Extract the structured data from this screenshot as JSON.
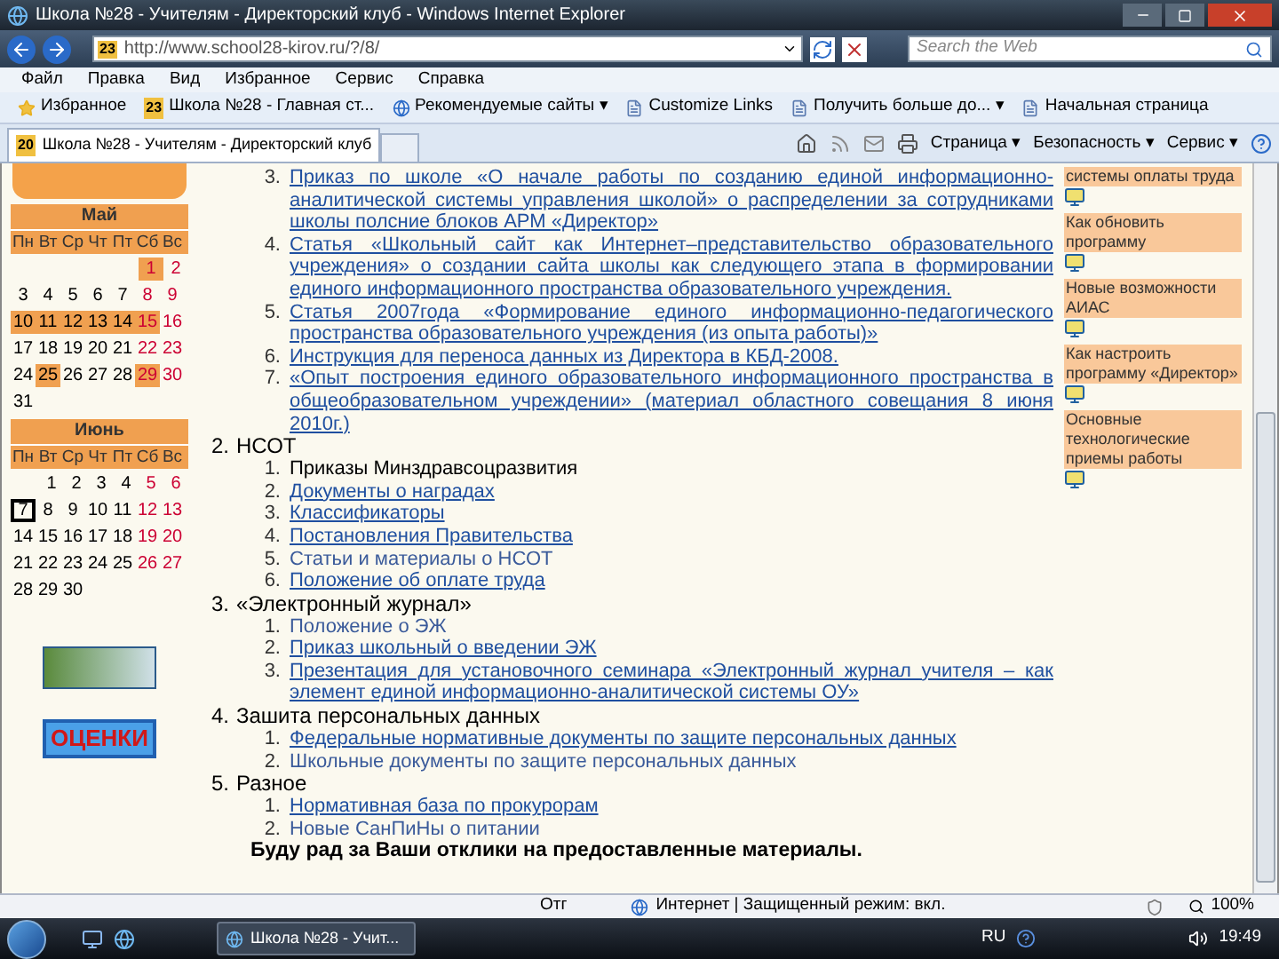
{
  "window": {
    "title": "Школа №28 - Учителям - Директорский клуб - Windows Internet Explorer"
  },
  "address_bar": {
    "favicon": "23",
    "url": "http://www.school28-kirov.ru/?/8/"
  },
  "search": {
    "placeholder": "Search the Web"
  },
  "menu": [
    "Файл",
    "Правка",
    "Вид",
    "Избранное",
    "Сервис",
    "Справка"
  ],
  "favorites_bar": [
    {
      "kind": "star",
      "label": "Избранное"
    },
    {
      "kind": "site",
      "label": "Школа №28 - Главная ст...",
      "badge": "23"
    },
    {
      "kind": "ie",
      "label": "Рекомендуемые сайты ▾"
    },
    {
      "kind": "page",
      "label": "Customize Links"
    },
    {
      "kind": "page",
      "label": "Получить больше до...  ▾"
    },
    {
      "kind": "page",
      "label": "Начальная страница"
    }
  ],
  "tabs": [
    {
      "label": "Школа №28 - Учителям - Директорский клуб",
      "favicon": "20",
      "selected": true
    }
  ],
  "command_bar": [
    "Страница ▾",
    "Безопасность ▾",
    "Сервис ▾"
  ],
  "calendar": {
    "months": [
      {
        "name": "Май",
        "weekdays": [
          "Пн",
          "Вт",
          "Ср",
          "Чт",
          "Пт",
          "Сб",
          "Вс"
        ],
        "weeks": [
          [
            {
              "day": "1",
              "highlighted": true,
              "weekend": true,
              "today": false
            },
            {
              "day": "2",
              "highlighted": false,
              "weekend": true,
              "today": false
            }
          ],
          [
            {
              "day": "3",
              "highlighted": false,
              "weekend": false,
              "today": false
            },
            {
              "day": "4",
              "highlighted": false,
              "weekend": false,
              "today": false
            },
            {
              "day": "5",
              "highlighted": false,
              "weekend": false,
              "today": false
            },
            {
              "day": "6",
              "highlighted": false,
              "weekend": false,
              "today": false
            },
            {
              "day": "7",
              "highlighted": false,
              "weekend": false,
              "today": false
            },
            {
              "day": "8",
              "highlighted": false,
              "weekend": true,
              "today": false
            },
            {
              "day": "9",
              "highlighted": false,
              "weekend": true,
              "today": false
            }
          ],
          [
            {
              "day": "10",
              "highlighted": true,
              "weekend": false,
              "today": false
            },
            {
              "day": "11",
              "highlighted": true,
              "weekend": false,
              "today": false
            },
            {
              "day": "12",
              "highlighted": true,
              "weekend": false,
              "today": false
            },
            {
              "day": "13",
              "highlighted": true,
              "weekend": false,
              "today": false
            },
            {
              "day": "14",
              "highlighted": true,
              "weekend": false,
              "today": false
            },
            {
              "day": "15",
              "highlighted": true,
              "weekend": true,
              "today": false
            },
            {
              "day": "16",
              "highlighted": false,
              "weekend": true,
              "today": false
            }
          ],
          [
            {
              "day": "17",
              "highlighted": false,
              "weekend": false,
              "today": false
            },
            {
              "day": "18",
              "highlighted": false,
              "weekend": false,
              "today": false
            },
            {
              "day": "19",
              "highlighted": false,
              "weekend": false,
              "today": false
            },
            {
              "day": "20",
              "highlighted": false,
              "weekend": false,
              "today": false
            },
            {
              "day": "21",
              "highlighted": false,
              "weekend": false,
              "today": false
            },
            {
              "day": "22",
              "highlighted": false,
              "weekend": true,
              "today": false
            },
            {
              "day": "23",
              "highlighted": false,
              "weekend": true,
              "today": false
            }
          ],
          [
            {
              "day": "24",
              "highlighted": false,
              "weekend": false,
              "today": false
            },
            {
              "day": "25",
              "highlighted": true,
              "weekend": false,
              "today": false
            },
            {
              "day": "26",
              "highlighted": false,
              "weekend": false,
              "today": false
            },
            {
              "day": "27",
              "highlighted": false,
              "weekend": false,
              "today": false
            },
            {
              "day": "28",
              "highlighted": false,
              "weekend": false,
              "today": false
            },
            {
              "day": "29",
              "highlighted": true,
              "weekend": true,
              "today": false
            },
            {
              "day": "30",
              "highlighted": false,
              "weekend": true,
              "today": false
            }
          ],
          [
            {
              "day": "31",
              "highlighted": false,
              "weekend": false,
              "today": false
            }
          ]
        ]
      },
      {
        "name": "Июнь",
        "weekdays": [
          "Пн",
          "Вт",
          "Ср",
          "Чт",
          "Пт",
          "Сб",
          "Вс"
        ],
        "weeks": [
          [
            {
              "day": "1",
              "highlighted": false,
              "weekend": false,
              "today": false
            },
            {
              "day": "2",
              "highlighted": false,
              "weekend": false,
              "today": false
            },
            {
              "day": "3",
              "highlighted": false,
              "weekend": false,
              "today": false
            },
            {
              "day": "4",
              "highlighted": false,
              "weekend": false,
              "today": false
            },
            {
              "day": "5",
              "highlighted": false,
              "weekend": true,
              "today": false
            },
            {
              "day": "6",
              "highlighted": false,
              "weekend": true,
              "today": false
            }
          ],
          [
            {
              "day": "7",
              "highlighted": false,
              "weekend": false,
              "today": true
            },
            {
              "day": "8",
              "highlighted": false,
              "weekend": false,
              "today": false
            },
            {
              "day": "9",
              "highlighted": false,
              "weekend": false,
              "today": false
            },
            {
              "day": "10",
              "highlighted": false,
              "weekend": false,
              "today": false
            },
            {
              "day": "11",
              "highlighted": false,
              "weekend": false,
              "today": false
            },
            {
              "day": "12",
              "highlighted": false,
              "weekend": true,
              "today": false
            },
            {
              "day": "13",
              "highlighted": false,
              "weekend": true,
              "today": false
            }
          ],
          [
            {
              "day": "14",
              "highlighted": false,
              "weekend": false,
              "today": false
            },
            {
              "day": "15",
              "highlighted": false,
              "weekend": false,
              "today": false
            },
            {
              "day": "16",
              "highlighted": false,
              "weekend": false,
              "today": false
            },
            {
              "day": "17",
              "highlighted": false,
              "weekend": false,
              "today": false
            },
            {
              "day": "18",
              "highlighted": false,
              "weekend": false,
              "today": false
            },
            {
              "day": "19",
              "highlighted": false,
              "weekend": true,
              "today": false
            },
            {
              "day": "20",
              "highlighted": false,
              "weekend": true,
              "today": false
            }
          ],
          [
            {
              "day": "21",
              "highlighted": false,
              "weekend": false,
              "today": false
            },
            {
              "day": "22",
              "highlighted": false,
              "weekend": false,
              "today": false
            },
            {
              "day": "23",
              "highlighted": false,
              "weekend": false,
              "today": false
            },
            {
              "day": "24",
              "highlighted": false,
              "weekend": false,
              "today": false
            },
            {
              "day": "25",
              "highlighted": false,
              "weekend": false,
              "today": false
            },
            {
              "day": "26",
              "highlighted": false,
              "weekend": true,
              "today": false
            },
            {
              "day": "27",
              "highlighted": false,
              "weekend": true,
              "today": false
            }
          ],
          [
            {
              "day": "28",
              "highlighted": false,
              "weekend": false,
              "today": false
            },
            {
              "day": "29",
              "highlighted": false,
              "weekend": false,
              "today": false
            },
            {
              "day": "30",
              "highlighted": false,
              "weekend": false,
              "today": false
            }
          ]
        ]
      }
    ]
  },
  "grades_banner": "ОЦЕНКИ",
  "sections": [
    {
      "items": [
        {
          "number": "3.",
          "kind": "link",
          "text": "Приказ по школе «О начале работы по созданию единой информационно-аналитической системы управления школой» о распределении за сотрудниками школы полсние блоков АРМ «Директор»"
        },
        {
          "number": "4.",
          "kind": "link",
          "text": "Статья «Школьный сайт как Интернет–представительство образовательного учреждения» о создании сайта школы как следующего этапа в формировании единого информационного пространства образовательного учреждения."
        },
        {
          "number": "5.",
          "kind": "link",
          "text": "Статья 2007года «Формирование единого информационно-педагогического пространства образовательного учреждения (из опыта работы)»"
        },
        {
          "number": "6.",
          "kind": "link",
          "text": "Инструкция для переноса данных из Директора в КБД-2008."
        },
        {
          "number": "7.",
          "kind": "link",
          "text": "«Опыт построения единого образовательного информационного пространства в общеобразовательном учреждении» (материал областного совещания 8 июня 2010г.)"
        }
      ]
    },
    {
      "number": "2.",
      "title": "НСОТ",
      "items": [
        {
          "number": "1.",
          "kind": "plain",
          "text": "Приказы Минздравсоцразвития"
        },
        {
          "number": "2.",
          "kind": "link",
          "text": "Документы о наградах"
        },
        {
          "number": "3.",
          "kind": "link",
          "text": "Классификаторы"
        },
        {
          "number": "4.",
          "kind": "link",
          "text": "Постановления Правительства"
        },
        {
          "number": "5.",
          "kind": "text",
          "text": "Статьи и материалы о НСОТ"
        },
        {
          "number": "6.",
          "kind": "link",
          "text": "Положение об оплате труда"
        }
      ]
    },
    {
      "number": "3.",
      "title": "«Электронный журнал»",
      "items": [
        {
          "number": "1.",
          "kind": "text",
          "text": "Положение о ЭЖ"
        },
        {
          "number": "2.",
          "kind": "link",
          "text": "Приказ школьный о введении ЭЖ"
        },
        {
          "number": "3.",
          "kind": "link",
          "text": "Презентация для установочного семинара «Электронный журнал учителя – как элемент единой информационно-аналитической системы ОУ»"
        }
      ]
    },
    {
      "number": "4.",
      "title": "Зашита персональных данных",
      "items": [
        {
          "number": "1.",
          "kind": "link",
          "text": "Федеральные нормативные документы по защите персональных данных"
        },
        {
          "number": "2.",
          "kind": "text",
          "text": "Школьные документы по защите персональных данных"
        }
      ]
    },
    {
      "number": "5.",
      "title": "Разное",
      "items": [
        {
          "number": "1.",
          "kind": "link",
          "text": "Нормативная база по прокурорам"
        },
        {
          "number": "2.",
          "kind": "text",
          "text": "Новые СанПиНы о питании"
        }
      ]
    }
  ],
  "closing_note": "Буду рад за Ваши отклики на предоставленные материалы.",
  "right_sidebar": [
    "системы оплаты труда",
    "Как обновить программу",
    "Новые возможности АИАС",
    "Как настроить программу «Директор»",
    "Основные технологические приемы работы"
  ],
  "status_bar": {
    "left": "Отг",
    "zone": "Интернет | Защищенный режим: вкл.",
    "zoom": "100%"
  },
  "taskbar": {
    "task": "Школа №28 - Учит...",
    "language": "RU",
    "clock": "19:49"
  }
}
